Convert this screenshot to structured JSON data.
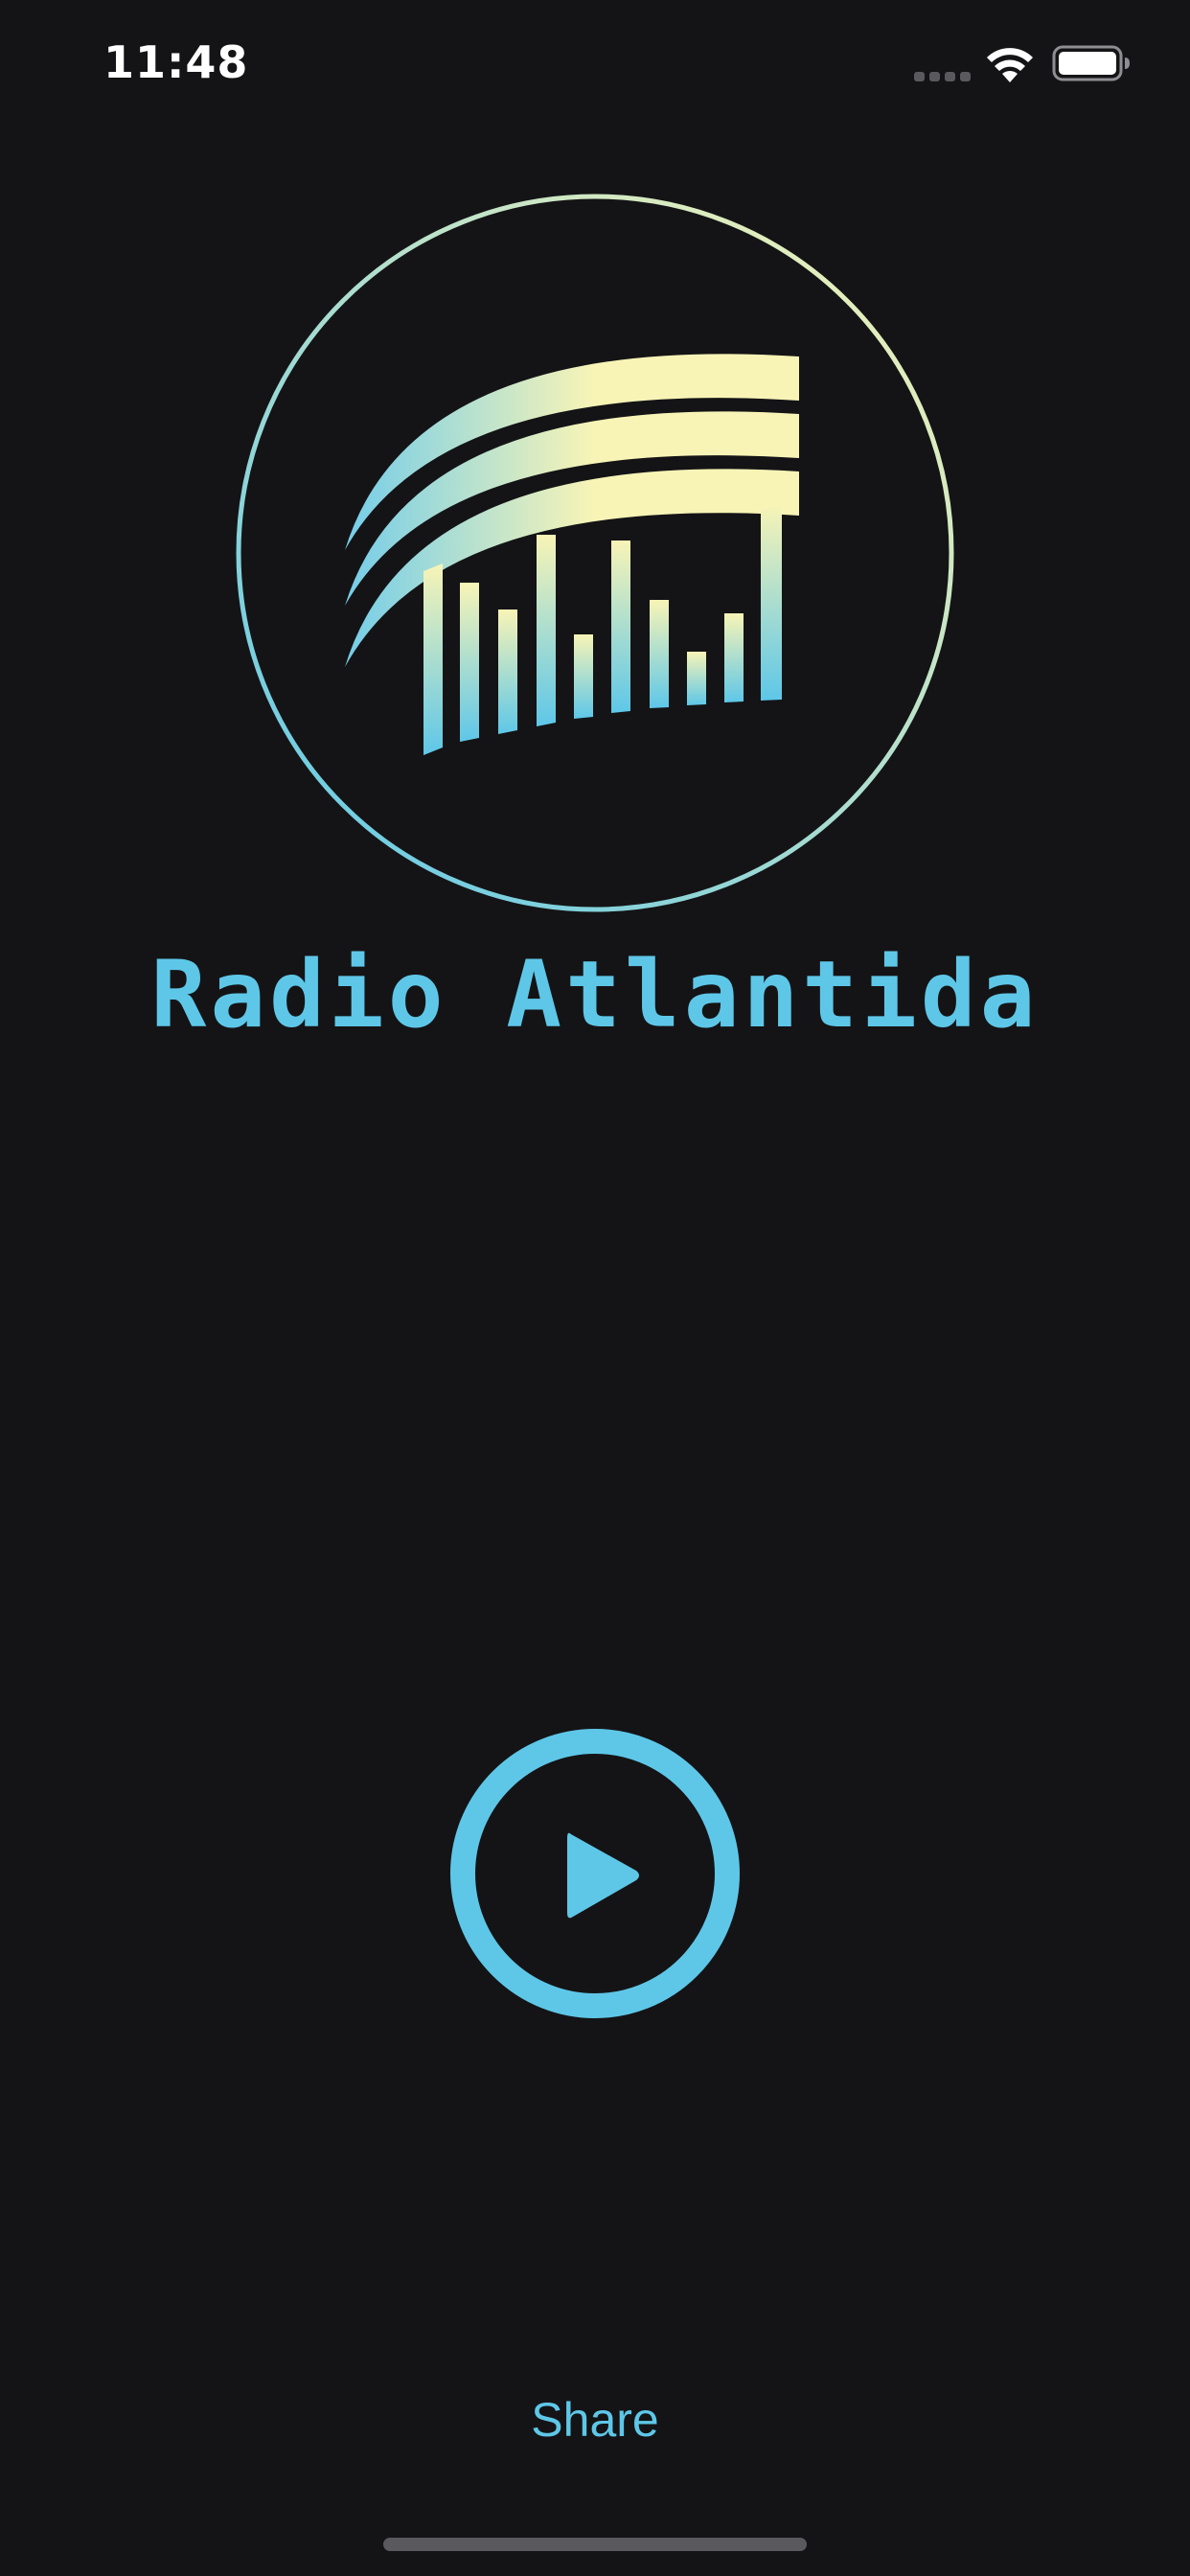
{
  "status_bar": {
    "time": "11:48"
  },
  "station": {
    "name": "Radio Atlantida"
  },
  "player": {
    "state_icon": "play-icon"
  },
  "actions": {
    "share_label": "Share"
  },
  "colors": {
    "background": "#141416",
    "accent_blue": "#5ec7e8",
    "accent_yellow": "#f8f4b6",
    "text_white": "#ffffff"
  }
}
